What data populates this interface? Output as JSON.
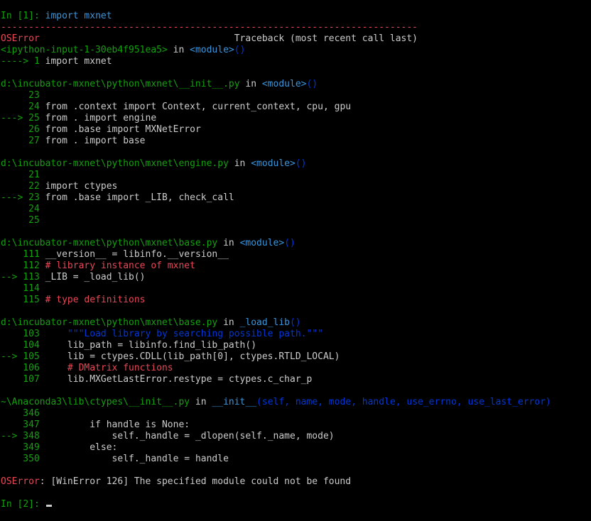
{
  "terminal": {
    "colors": {
      "background": "#000000",
      "default": "#cccccc",
      "prompt_green": "#13a10e",
      "number_yellow": "#c19c00",
      "cyan": "#3a96dd",
      "red": "#e74856",
      "blue": "#0037da"
    },
    "prompt1": {
      "in": "In [",
      "num": "1",
      "close": "]: ",
      "code": "import mxnet"
    },
    "separator": "---------------------------------------------------------------------------",
    "error_name": "OSError",
    "traceback_header": "                                   Traceback (most recent call last)",
    "frame1": {
      "file": "<ipython-input-1-30eb4f951ea5>",
      "in": " in ",
      "func": "<module>",
      "parens": "()",
      "lines": [
        {
          "prefix": "----> 1 ",
          "code": "import mxnet"
        }
      ]
    },
    "frame2": {
      "file": "d:\\incubator-mxnet\\python\\mxnet\\__init__.py",
      "in": " in ",
      "func": "<module>",
      "parens": "()",
      "l23": "     23",
      "l24": "     24 ",
      "l24code": "from .context import Context, current_context, cpu, gpu",
      "l25": "---> 25 ",
      "l25code": "from . import engine",
      "l26": "     26 ",
      "l26code": "from .base import MXNetError",
      "l27": "     27 ",
      "l27code": "from . import base"
    },
    "frame3": {
      "file": "d:\\incubator-mxnet\\python\\mxnet\\engine.py",
      "in": " in ",
      "func": "<module>",
      "parens": "()",
      "l21": "     21",
      "l22": "     22 ",
      "l22code": "import ctypes",
      "l23": "---> 23 ",
      "l23code": "from .base import _LIB, check_call",
      "l24": "     24",
      "l25": "     25"
    },
    "frame4": {
      "file": "d:\\incubator-mxnet\\python\\mxnet\\base.py",
      "in": " in ",
      "func": "<module>",
      "parens": "()",
      "l111": "    111 ",
      "l111code": "__version__ = libinfo.__version__",
      "l112": "    112 ",
      "l112code": "# library instance of mxnet",
      "l113": "--> 113 ",
      "l113code": "_LIB = _load_lib()",
      "l114": "    114",
      "l115": "    115 ",
      "l115code": "# type definitions"
    },
    "frame5": {
      "file": "d:\\incubator-mxnet\\python\\mxnet\\base.py",
      "in": " in ",
      "func": "_load_lib",
      "parens": "()",
      "l103": "    103     ",
      "l103code": "\"\"\"Load library by searching possible path.\"\"\"",
      "l104": "    104     ",
      "l104code": "lib_path = libinfo.find_lib_path()",
      "l105": "--> 105     ",
      "l105code": "lib = ctypes.CDLL(lib_path[0], ctypes.RTLD_LOCAL)",
      "l106": "    106     ",
      "l106code": "# DMatrix functions",
      "l107": "    107     ",
      "l107code": "lib.MXGetLastError.restype = ctypes.c_char_p"
    },
    "frame6": {
      "file": "~\\Anaconda3\\lib\\ctypes\\__init__.py",
      "in": " in ",
      "func": "__init__",
      "args": "(self, name, mode, handle, use_errno, use_last_error)",
      "l346": "    346",
      "l347": "    347         ",
      "l347code": "if handle is None:",
      "l348": "--> 348             ",
      "l348code": "self._handle = _dlopen(self._name, mode)",
      "l349": "    349         ",
      "l349code": "else:",
      "l350": "    350             ",
      "l350code": "self._handle = handle"
    },
    "final_error": {
      "name": "OSError",
      "message": ": [WinError 126] The specified module could not be found"
    },
    "prompt2": {
      "in": "In [",
      "num": "2",
      "close": "]: "
    }
  }
}
